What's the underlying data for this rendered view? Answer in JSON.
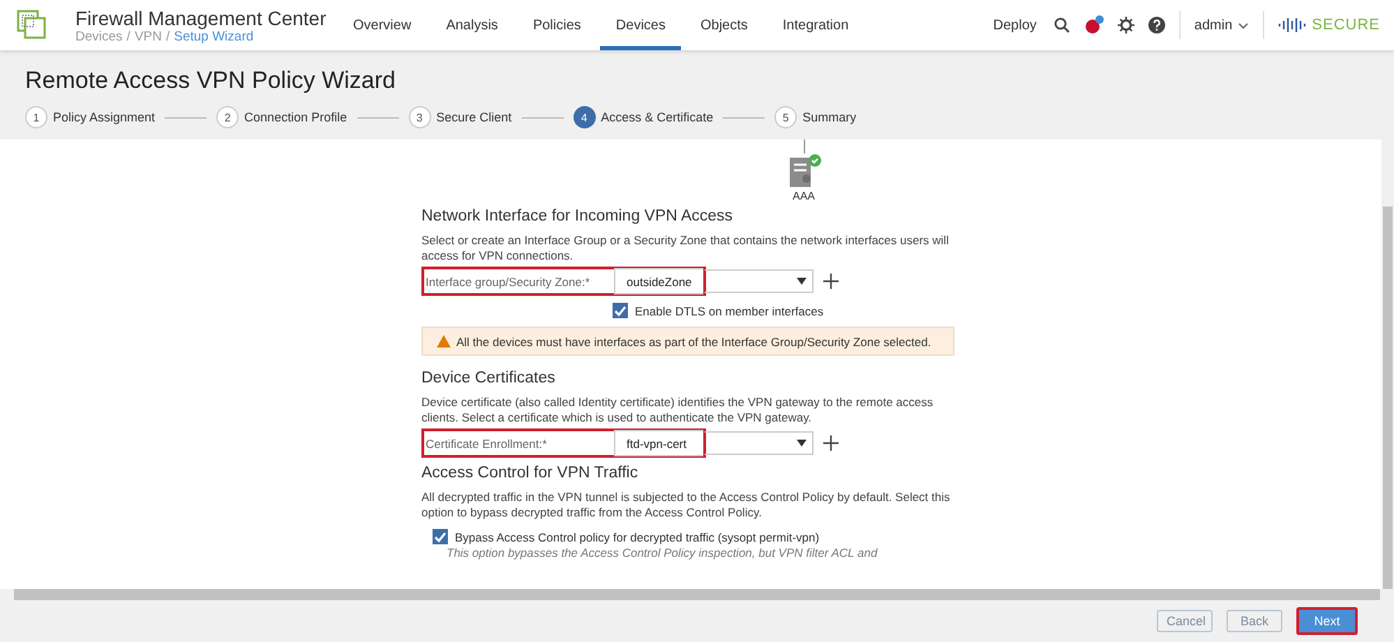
{
  "header": {
    "title": "Firewall Management Center",
    "breadcrumb": [
      "Devices",
      "VPN"
    ],
    "breadcrumb_separator": "/",
    "breadcrumb_current": "Setup Wizard",
    "nav": [
      {
        "label": "Overview",
        "selected": false
      },
      {
        "label": "Analysis",
        "selected": false
      },
      {
        "label": "Policies",
        "selected": false
      },
      {
        "label": "Devices",
        "selected": true
      },
      {
        "label": "Objects",
        "selected": false
      },
      {
        "label": "Integration",
        "selected": false
      }
    ],
    "deploy": "Deploy",
    "user": "admin",
    "brand": "SECURE"
  },
  "page_title": "Remote Access VPN Policy Wizard",
  "steps": [
    {
      "number": "1",
      "label": "Policy Assignment",
      "selected": false
    },
    {
      "number": "2",
      "label": "Connection Profile",
      "selected": false
    },
    {
      "number": "3",
      "label": "Secure Client",
      "selected": false
    },
    {
      "number": "4",
      "label": "Access & Certificate",
      "selected": true
    },
    {
      "number": "5",
      "label": "Summary",
      "selected": false
    }
  ],
  "aaa_label": "AAA",
  "network": {
    "heading": "Network Interface for Incoming VPN Access",
    "description": "Select or create an Interface Group or a Security Zone that contains the network interfaces users will access for VPN connections.",
    "field_label": "Interface group/Security Zone:*",
    "value": "outsideZone",
    "dtls": {
      "label": "Enable DTLS on member interfaces",
      "checked": true
    },
    "warning": "All the devices must have interfaces as part of the Interface Group/Security Zone selected."
  },
  "certificates": {
    "heading": "Device Certificates",
    "description": "Device certificate (also called Identity certificate) identifies the VPN gateway to the remote access clients. Select a certificate which is used to authenticate the VPN gateway.",
    "field_label": "Certificate Enrollment:*",
    "value": "ftd-vpn-cert"
  },
  "access_control": {
    "heading": "Access Control for VPN Traffic",
    "description": "All decrypted traffic in the VPN tunnel is subjected to the Access Control Policy by default. Select this option to bypass decrypted traffic from the Access Control Policy.",
    "bypass": {
      "label": "Bypass Access Control policy for decrypted traffic (sysopt permit-vpn)",
      "checked": true
    },
    "note": "This option bypasses the Access Control Policy inspection, but VPN filter ACL and"
  },
  "buttons": [
    {
      "label": "Cancel",
      "kind": "secondary"
    },
    {
      "label": "Back",
      "kind": "secondary"
    },
    {
      "label": "Next",
      "kind": "primary"
    }
  ]
}
